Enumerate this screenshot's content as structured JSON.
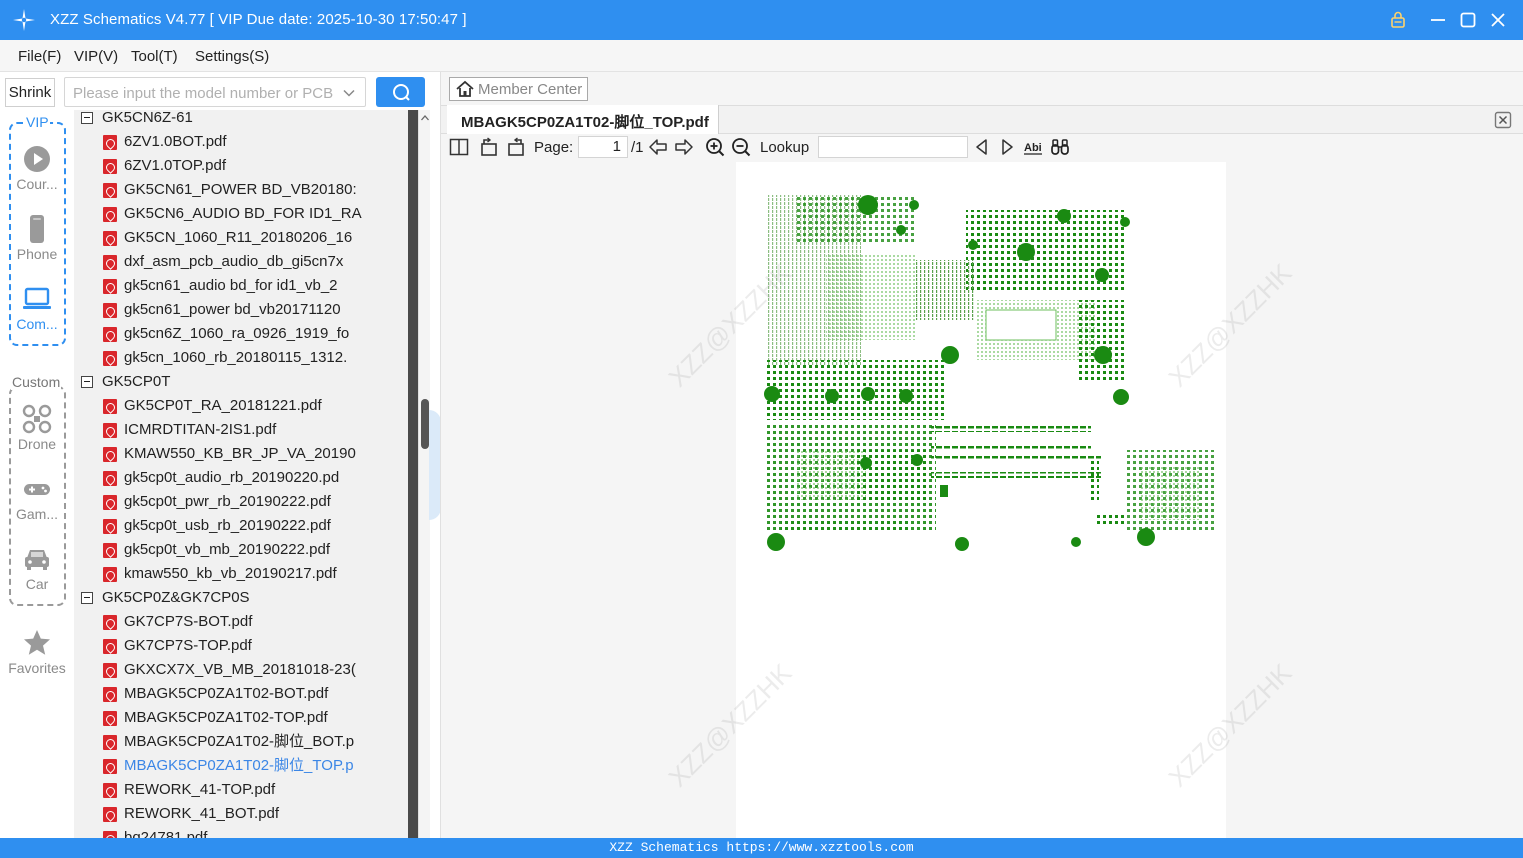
{
  "window": {
    "title": "XZZ Schematics V4.77 [ VIP Due date: 2025-10-30 17:50:47 ]"
  },
  "menu": [
    "File(F)",
    "VIP(V)",
    "Tool(T)",
    "Settings(S)"
  ],
  "search": {
    "shrink_label": "Shrink",
    "placeholder": "Please input the model number or PCB",
    "value": ""
  },
  "rail": {
    "vip_label": "VIP",
    "custom_label": "Custom",
    "vip_items": [
      {
        "label": "Cour...",
        "icon": "play-circle-icon",
        "active": false
      },
      {
        "label": "Phone",
        "icon": "phone-icon",
        "active": false
      },
      {
        "label": "Com...",
        "icon": "laptop-icon",
        "active": true
      }
    ],
    "custom_items": [
      {
        "label": "Drone",
        "icon": "drone-icon"
      },
      {
        "label": "Gam...",
        "icon": "gamepad-icon"
      },
      {
        "label": "Car",
        "icon": "car-icon"
      }
    ],
    "favorites_label": "Favorites"
  },
  "tree": [
    {
      "type": "folder",
      "label": "GK5CN6Z-61"
    },
    {
      "type": "file",
      "label": "6ZV1.0BOT.pdf"
    },
    {
      "type": "file",
      "label": "6ZV1.0TOP.pdf"
    },
    {
      "type": "file",
      "label": "GK5CN61_POWER BD_VB20180:"
    },
    {
      "type": "file",
      "label": "GK5CN6_AUDIO BD_FOR ID1_RA"
    },
    {
      "type": "file",
      "label": "GK5CN_1060_R11_20180206_16"
    },
    {
      "type": "file",
      "label": "dxf_asm_pcb_audio_db_gi5cn7x"
    },
    {
      "type": "file",
      "label": "gk5cn61_audio bd_for id1_vb_2"
    },
    {
      "type": "file",
      "label": "gk5cn61_power bd_vb20171120"
    },
    {
      "type": "file",
      "label": "gk5cn6Z_1060_ra_0926_1919_fo"
    },
    {
      "type": "file",
      "label": "gk5cn_1060_rb_20180115_1312."
    },
    {
      "type": "folder",
      "label": "GK5CP0T"
    },
    {
      "type": "file",
      "label": "GK5CP0T_RA_20181221.pdf"
    },
    {
      "type": "file",
      "label": "ICMRDTITAN-2IS1.pdf"
    },
    {
      "type": "file",
      "label": "KMAW550_KB_BR_JP_VA_20190"
    },
    {
      "type": "file",
      "label": "gk5cp0t_audio_rb_20190220.pd"
    },
    {
      "type": "file",
      "label": "gk5cp0t_pwr_rb_20190222.pdf"
    },
    {
      "type": "file",
      "label": "gk5cp0t_usb_rb_20190222.pdf"
    },
    {
      "type": "file",
      "label": "gk5cp0t_vb_mb_20190222.pdf"
    },
    {
      "type": "file",
      "label": "kmaw550_kb_vb_20190217.pdf"
    },
    {
      "type": "folder",
      "label": "GK5CP0Z&GK7CP0S"
    },
    {
      "type": "file",
      "label": "GK7CP7S-BOT.pdf"
    },
    {
      "type": "file",
      "label": "GK7CP7S-TOP.pdf"
    },
    {
      "type": "file",
      "label": "GKXCX7X_VB_MB_20181018-23("
    },
    {
      "type": "file",
      "label": "MBAGK5CP0ZA1T02-BOT.pdf"
    },
    {
      "type": "file",
      "label": "MBAGK5CP0ZA1T02-TOP.pdf"
    },
    {
      "type": "file",
      "label": "MBAGK5CP0ZA1T02-脚位_BOT.p"
    },
    {
      "type": "file",
      "label": "MBAGK5CP0ZA1T02-脚位_TOP.p",
      "selected": true
    },
    {
      "type": "file",
      "label": "REWORK_41-TOP.pdf"
    },
    {
      "type": "file",
      "label": "REWORK_41_BOT.pdf"
    },
    {
      "type": "file",
      "label": "bq24781.pdf"
    }
  ],
  "viewer": {
    "member_center": "Member Center",
    "tab_title": "MBAGK5CP0ZA1T02-脚位_TOP.pdf",
    "page_label": "Page:",
    "page_current": "1",
    "page_total": "/1",
    "lookup_label": "Lookup",
    "lookup_value": "",
    "watermark": "XZZ@XZZHK"
  },
  "status": {
    "text": "XZZ Schematics https://www.xzztools.com"
  },
  "colors": {
    "accent": "#2f8ff0",
    "pcb_green": "#1a8a12",
    "selected_file": "#3b86e6",
    "pdf_red": "#d9262b"
  }
}
